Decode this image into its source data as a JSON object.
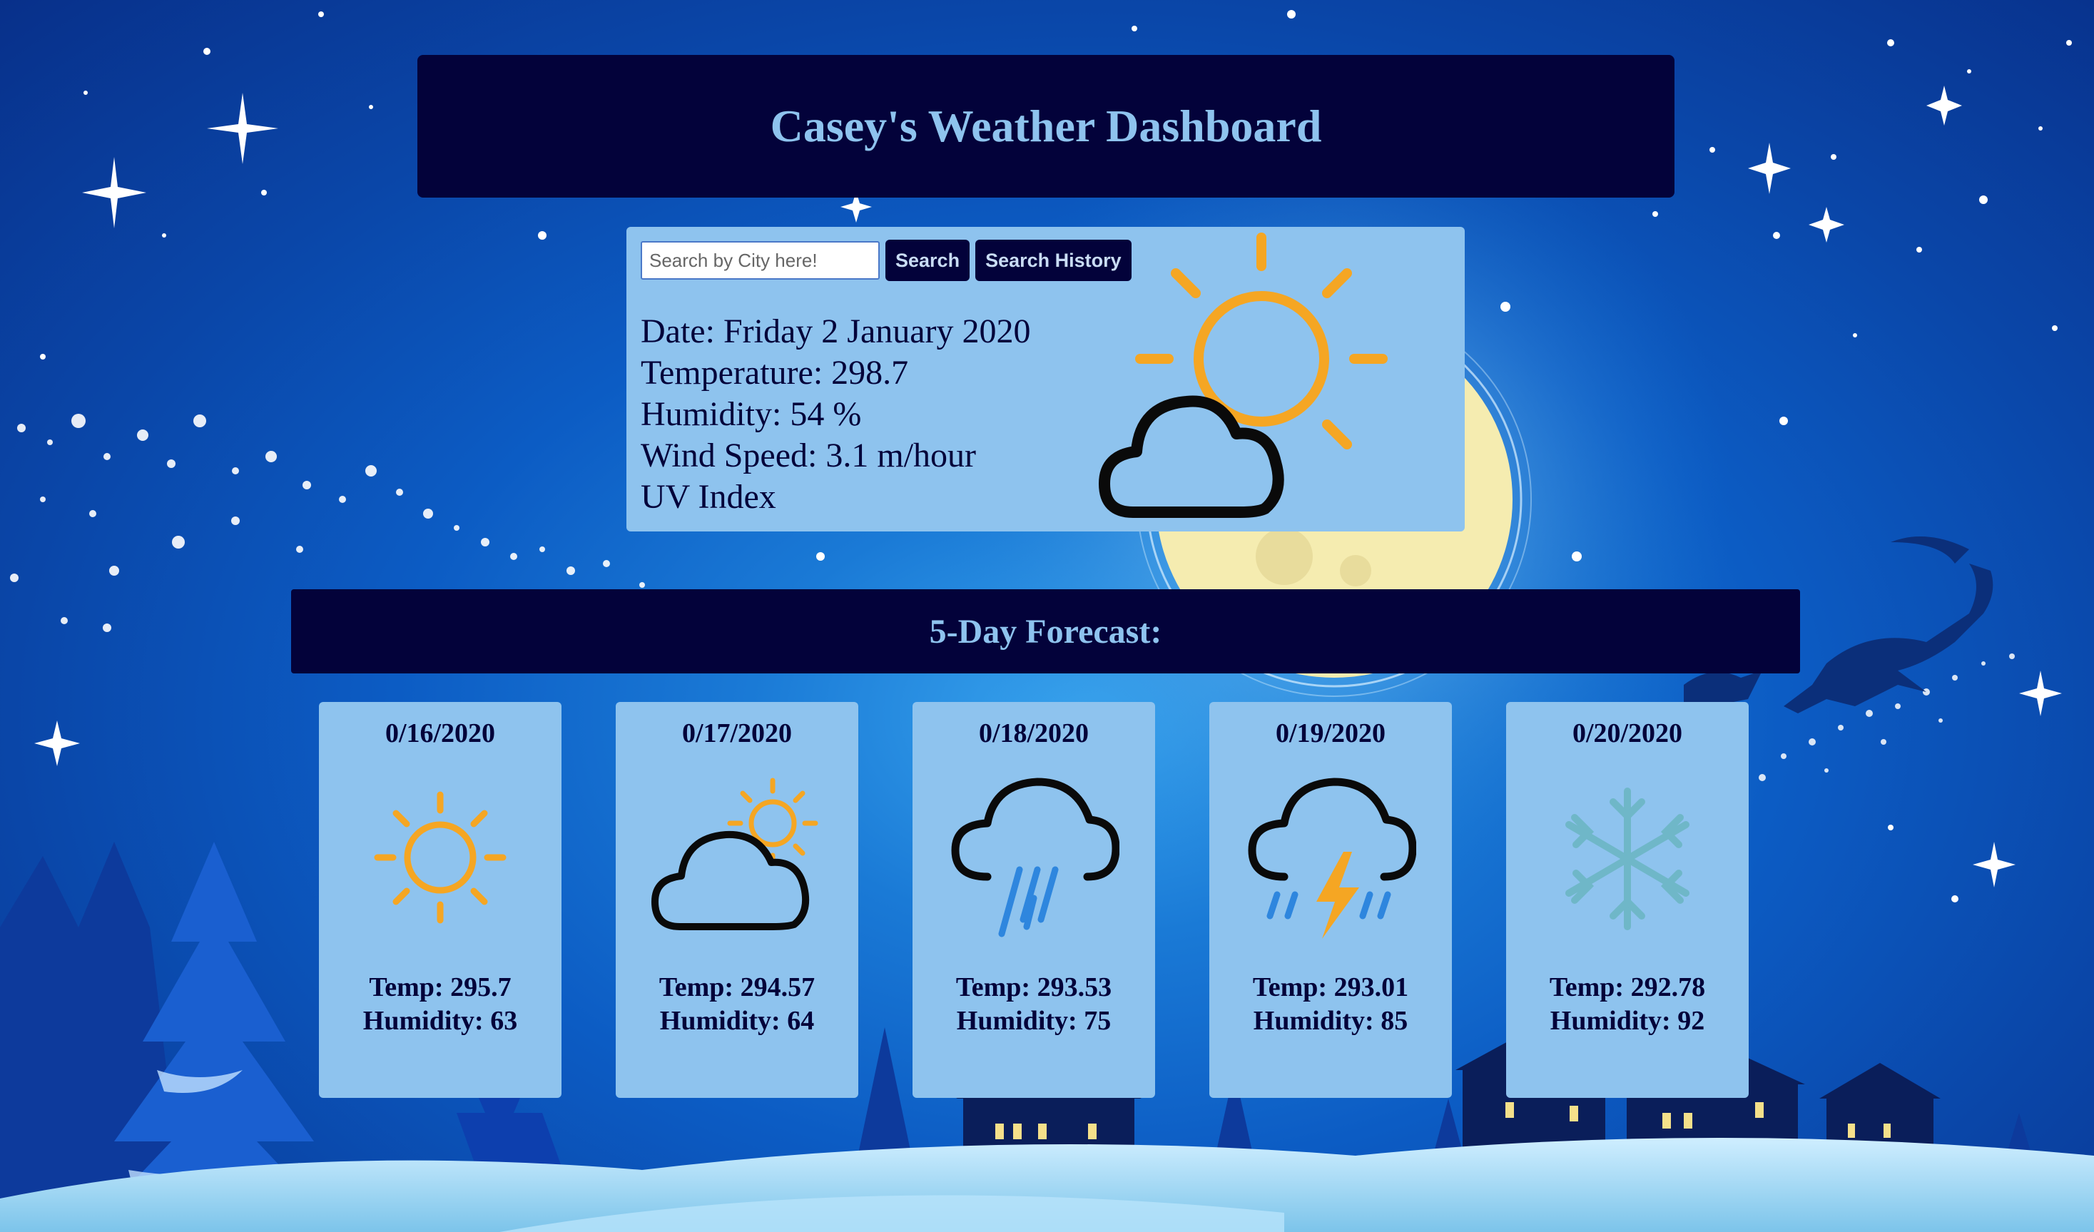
{
  "colors": {
    "panel_dark": "#03023a",
    "panel_light": "#8ec3ee",
    "title_text": "#8ec3ee",
    "sun": "#f5a623",
    "rain": "#2e86de",
    "snow": "#6fb7c8"
  },
  "header": {
    "title": "Casey's Weather Dashboard"
  },
  "search": {
    "placeholder": "Search by City here!",
    "value": "",
    "search_label": "Search",
    "history_label": "Search History"
  },
  "current": {
    "date": "Date: Friday 2 January 2020",
    "temperature": "Temperature: 298.7",
    "humidity": "Humidity: 54 %",
    "wind": "Wind Speed: 3.1 m/hour",
    "uv": "UV Index",
    "icon": "partly-cloudy-icon"
  },
  "forecast": {
    "heading": "5-Day Forecast:",
    "days": [
      {
        "date": "0/16/2020",
        "temp": "Temp: 295.7",
        "humidity": "Humidity: 63",
        "icon": "sun-icon"
      },
      {
        "date": "0/17/2020",
        "temp": "Temp: 294.57",
        "humidity": "Humidity: 64",
        "icon": "cloud-sun-icon"
      },
      {
        "date": "0/18/2020",
        "temp": "Temp: 293.53",
        "humidity": "Humidity: 75",
        "icon": "cloud-rain-icon"
      },
      {
        "date": "0/19/2020",
        "temp": "Temp: 293.01",
        "humidity": "Humidity: 85",
        "icon": "thunderstorm-icon"
      },
      {
        "date": "0/20/2020",
        "temp": "Temp: 292.78",
        "humidity": "Humidity: 92",
        "icon": "snowflake-icon"
      }
    ]
  }
}
